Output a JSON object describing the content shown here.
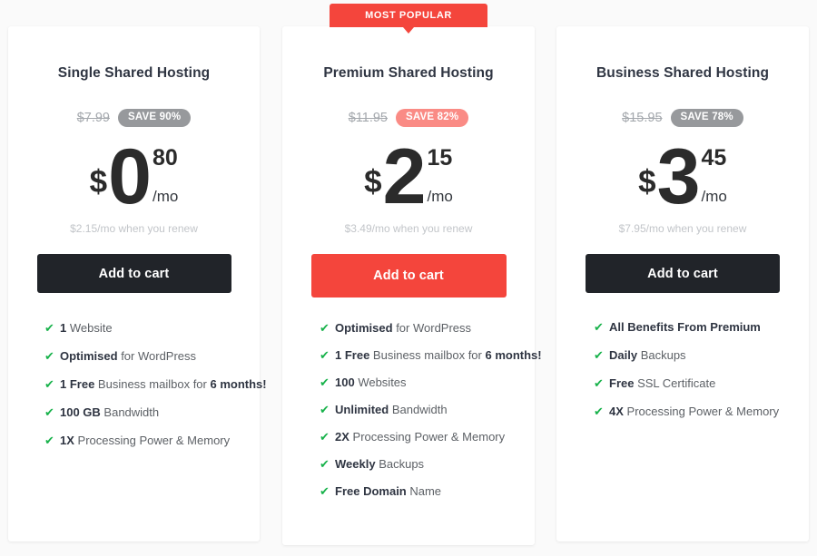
{
  "colors": {
    "accent_red": "#f4453c",
    "badge_gray": "#97999c",
    "badge_pink": "#fa8b85",
    "button_dark": "#212429",
    "check_green": "#18b24b",
    "title_dark": "#2f3542",
    "page_background": "#fafafa",
    "card_background": "#ffffff"
  },
  "popular_banner": {
    "label": "MOST POPULAR"
  },
  "plans": [
    {
      "title": "Single Shared Hosting",
      "old_price": "$7.99",
      "save_badge": "SAVE 90%",
      "currency": "$",
      "whole": "0",
      "cents": "80",
      "per": "/mo",
      "renew_note": "$2.15/mo when you renew",
      "cta_label": "Add to cart",
      "features": [
        {
          "strong": "1",
          "rest": " Website"
        },
        {
          "strong": "Optimised",
          "rest": " for WordPress"
        },
        {
          "strong": "1 Free",
          "rest": " Business mailbox for ",
          "strong2": "6 months!"
        },
        {
          "strong": "100 GB",
          "rest": " Bandwidth"
        },
        {
          "strong": "1X",
          "rest": " Processing Power & Memory"
        }
      ]
    },
    {
      "title": "Premium Shared Hosting",
      "old_price": "$11.95",
      "save_badge": "SAVE 82%",
      "currency": "$",
      "whole": "2",
      "cents": "15",
      "per": "/mo",
      "renew_note": "$3.49/mo when you renew",
      "cta_label": "Add to cart",
      "features": [
        {
          "strong": "Optimised",
          "rest": " for WordPress"
        },
        {
          "strong": "1 Free",
          "rest": " Business mailbox for ",
          "strong2": "6 months!"
        },
        {
          "strong": "100",
          "rest": " Websites"
        },
        {
          "strong": "Unlimited",
          "rest": " Bandwidth"
        },
        {
          "strong": "2X",
          "rest": " Processing Power & Memory"
        },
        {
          "strong": "Weekly",
          "rest": " Backups"
        },
        {
          "strong": "Free Domain",
          "rest": " Name"
        }
      ]
    },
    {
      "title": "Business Shared Hosting",
      "old_price": "$15.95",
      "save_badge": "SAVE 78%",
      "currency": "$",
      "whole": "3",
      "cents": "45",
      "per": "/mo",
      "renew_note": "$7.95/mo when you renew",
      "cta_label": "Add to cart",
      "features": [
        {
          "strong": "All Benefits From Premium",
          "rest": ""
        },
        {
          "strong": "Daily",
          "rest": " Backups"
        },
        {
          "strong": "Free",
          "rest": " SSL Certificate"
        },
        {
          "strong": "4X",
          "rest": " Processing Power & Memory"
        }
      ]
    }
  ],
  "icons": {
    "check": "✔"
  }
}
